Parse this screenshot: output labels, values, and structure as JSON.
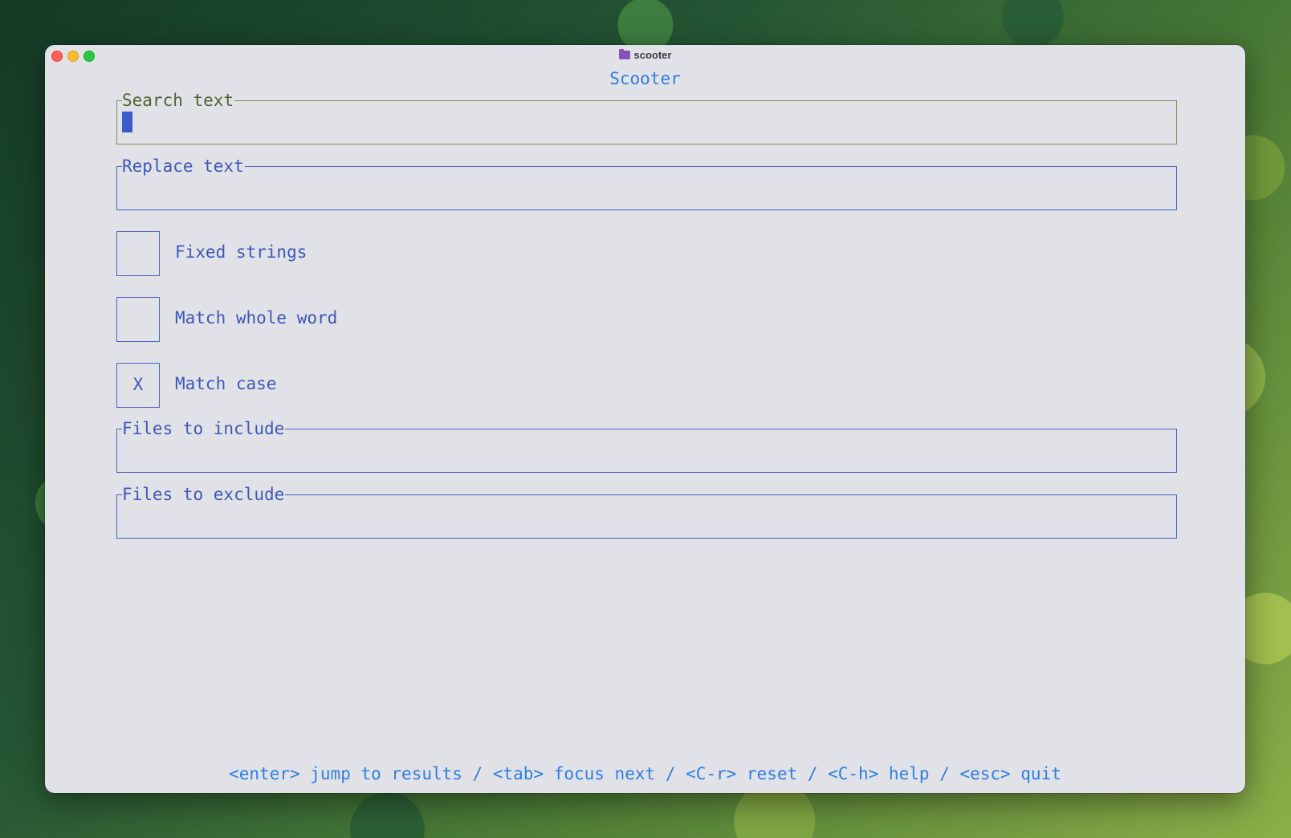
{
  "window": {
    "title": "scooter",
    "title_icon": "folder-icon"
  },
  "app": {
    "title": "Scooter"
  },
  "fields": {
    "search": {
      "label": "Search text",
      "value": ""
    },
    "replace": {
      "label": "Replace text",
      "value": ""
    },
    "include": {
      "label": "Files to include",
      "value": ""
    },
    "exclude": {
      "label": "Files to exclude",
      "value": ""
    }
  },
  "options": {
    "fixed_strings": {
      "label": "Fixed strings",
      "mark": ""
    },
    "match_whole_word": {
      "label": "Match whole word",
      "mark": ""
    },
    "match_case": {
      "label": "Match case",
      "mark": "X"
    }
  },
  "footer": {
    "hints": "<enter> jump to results / <tab> focus next / <C-r> reset / <C-h> help / <esc> quit"
  },
  "colors": {
    "background": "#e1e2e7",
    "accent": "#2f7de1",
    "border": "#4763c4",
    "focused_label": "#4f6432"
  }
}
